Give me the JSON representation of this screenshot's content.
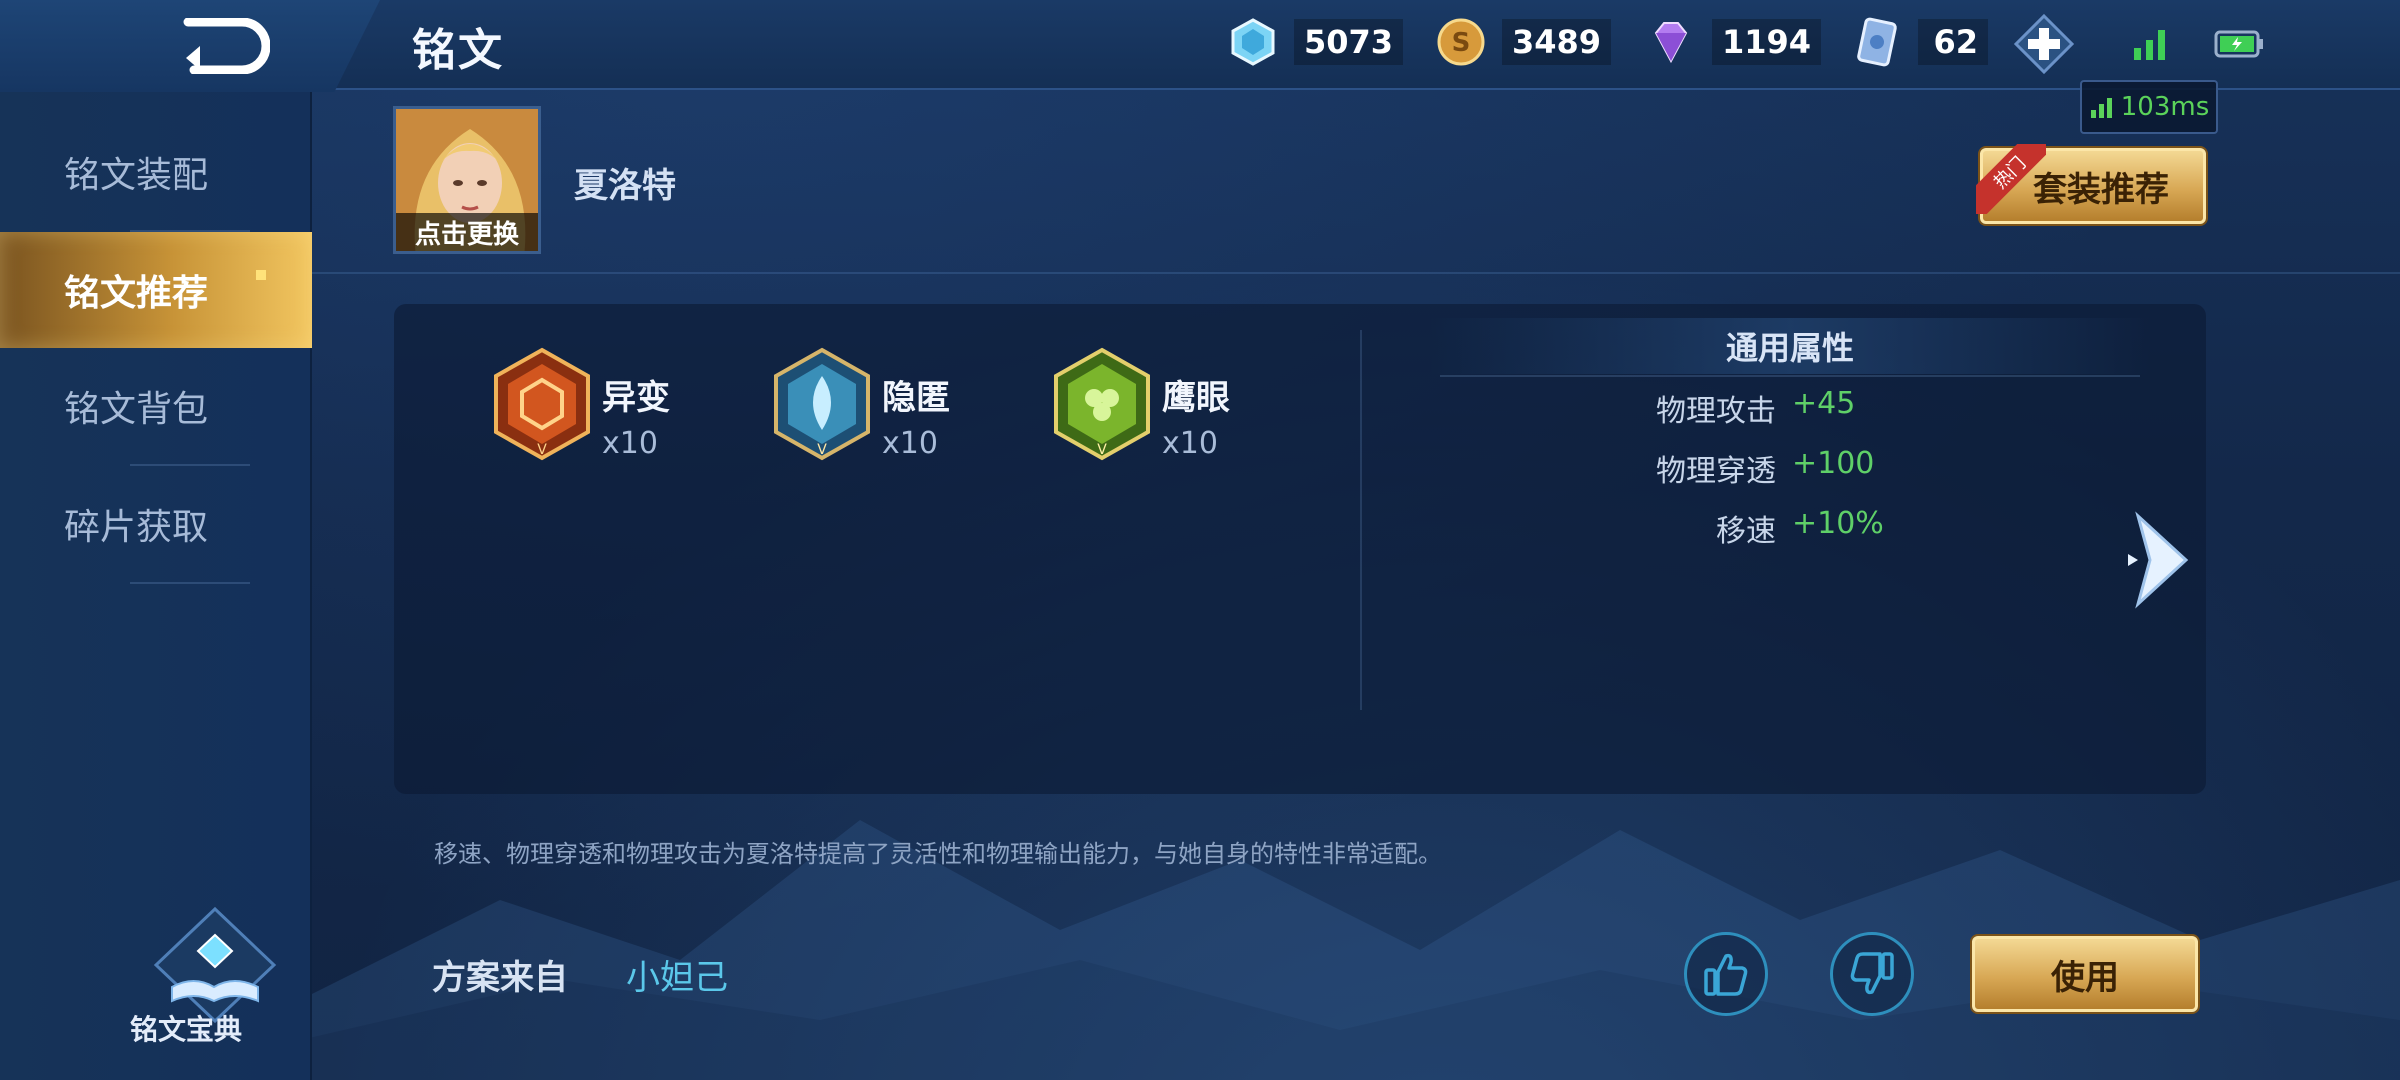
{
  "header": {
    "title": "铭文",
    "currencies": [
      {
        "icon": "crystal-icon",
        "value": "5073"
      },
      {
        "icon": "gold-coin-icon",
        "value": "3489"
      },
      {
        "icon": "diamond-icon",
        "value": "1194"
      },
      {
        "icon": "rune-card-icon",
        "value": "62"
      }
    ],
    "ping": "103ms"
  },
  "sidebar": {
    "items": [
      {
        "label": "铭文装配",
        "active": false
      },
      {
        "label": "铭文推荐",
        "active": true
      },
      {
        "label": "铭文背包",
        "active": false
      },
      {
        "label": "碎片获取",
        "active": false
      }
    ],
    "codex_label": "铭文宝典"
  },
  "hero": {
    "name": "夏洛特",
    "change_label": "点击更换"
  },
  "suit_button": {
    "label": "套装推荐",
    "tag": "热门"
  },
  "runes": [
    {
      "name": "异变",
      "count": "x10",
      "color": "#c2531e"
    },
    {
      "name": "隐匿",
      "count": "x10",
      "color": "#3a8fb8"
    },
    {
      "name": "鹰眼",
      "count": "x10",
      "color": "#7bb52c"
    }
  ],
  "attributes": {
    "title": "通用属性",
    "rows": [
      {
        "key": "物理攻击",
        "value": "+45"
      },
      {
        "key": "物理穿透",
        "value": "+100"
      },
      {
        "key": "移速",
        "value": "+10%"
      }
    ]
  },
  "description": "移速、物理穿透和物理攻击为夏洛特提高了灵活性和物理输出能力，与她自身的特性非常适配。",
  "source": {
    "label": "方案来自",
    "name": "小妲己"
  },
  "use_button": "使用",
  "colors": {
    "accent_gold": "#d8a855",
    "positive_green": "#5fd068",
    "link_cyan": "#5bc8ea"
  }
}
